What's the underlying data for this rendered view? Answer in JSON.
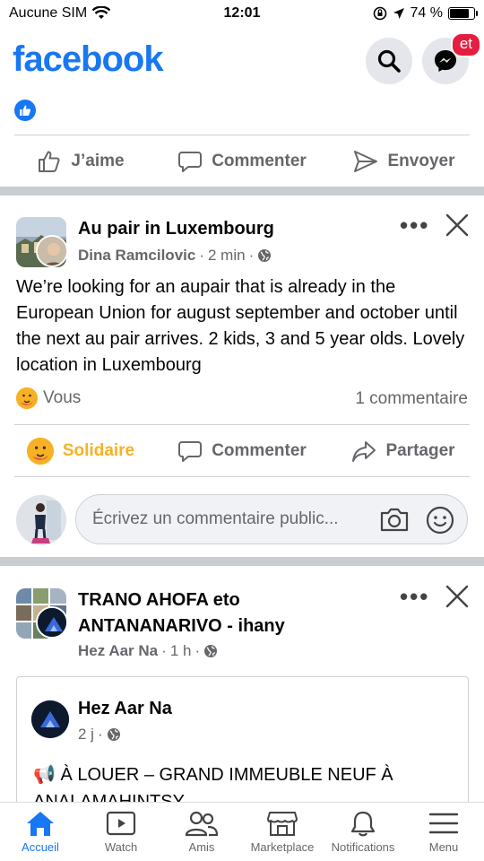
{
  "status_bar": {
    "carrier": "Aucune SIM",
    "time": "12:01",
    "battery": "74 %",
    "battery_level": 0.74
  },
  "header": {
    "logo": "facebook",
    "messenger_badge": "et"
  },
  "top_actions": {
    "like": "J’aime",
    "comment": "Commenter",
    "send": "Envoyer"
  },
  "post1": {
    "title": "Au pair in Luxembourg",
    "author": "Dina Ramcilovic",
    "time": "2 min",
    "sep": "·",
    "text": "We’re looking for an aupair that is already in the European Union for august september and october until the next au pair arrives. 2 kids, 3 and 5 year olds. Lovely location in Luxembourg",
    "reaction_label": "Vous",
    "comments_count": "1 commentaire",
    "actions": {
      "react": "Solidaire",
      "comment": "Commenter",
      "share": "Partager"
    },
    "comment_placeholder": "Écrivez un commentaire public..."
  },
  "post2": {
    "title_line1": "TRANO AHOFA eto",
    "title_line2": "ANTANANARIVO - ihany",
    "author": "Hez Aar Na",
    "time": "1 h",
    "sep": "·",
    "shared": {
      "author": "Hez Aar Na",
      "time": "2 j",
      "sep": "·",
      "text_line1": "📢 À LOUER – GRAND IMMEUBLE NEUF À",
      "text_line2": "ANALAMAHINTSY"
    }
  },
  "tabbar": [
    {
      "label": "Accueil",
      "icon": "home-icon",
      "active": true
    },
    {
      "label": "Watch",
      "icon": "watch-icon",
      "active": false
    },
    {
      "label": "Amis",
      "icon": "friends-icon",
      "active": false
    },
    {
      "label": "Marketplace",
      "icon": "marketplace-icon",
      "active": false
    },
    {
      "label": "Notifications",
      "icon": "bell-icon",
      "active": false
    },
    {
      "label": "Menu",
      "icon": "menu-icon",
      "active": false
    }
  ],
  "colors": {
    "brand": "#1877f2",
    "solidaire": "#f7b125",
    "badge": "#e41e3f"
  }
}
